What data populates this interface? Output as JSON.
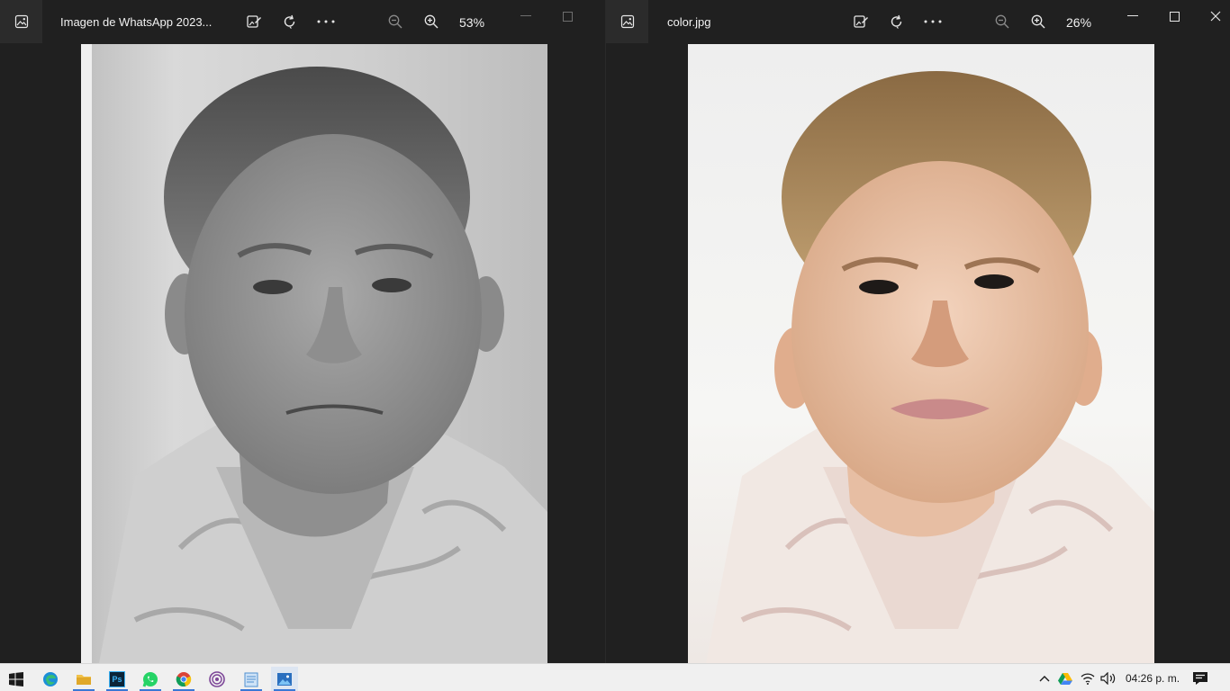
{
  "windows": [
    {
      "title": "Imagen de WhatsApp 2023...",
      "zoom": "53%",
      "image_description": "grayscale"
    },
    {
      "title": "color.jpg",
      "zoom": "26%",
      "image_description": "colorized"
    }
  ],
  "taskbar": {
    "apps": [
      "start-icon",
      "edge-icon",
      "file-explorer-icon",
      "photoshop-icon",
      "whatsapp-icon",
      "chrome-icon",
      "tor-browser-icon",
      "notepad-icon",
      "photos-icon"
    ],
    "photoshop_label": "Ps",
    "clock": "04:26 p. m."
  },
  "colors": {
    "accent": "#3a78d6",
    "titlebar": "#202020",
    "taskbar": "#f0f0f0"
  }
}
